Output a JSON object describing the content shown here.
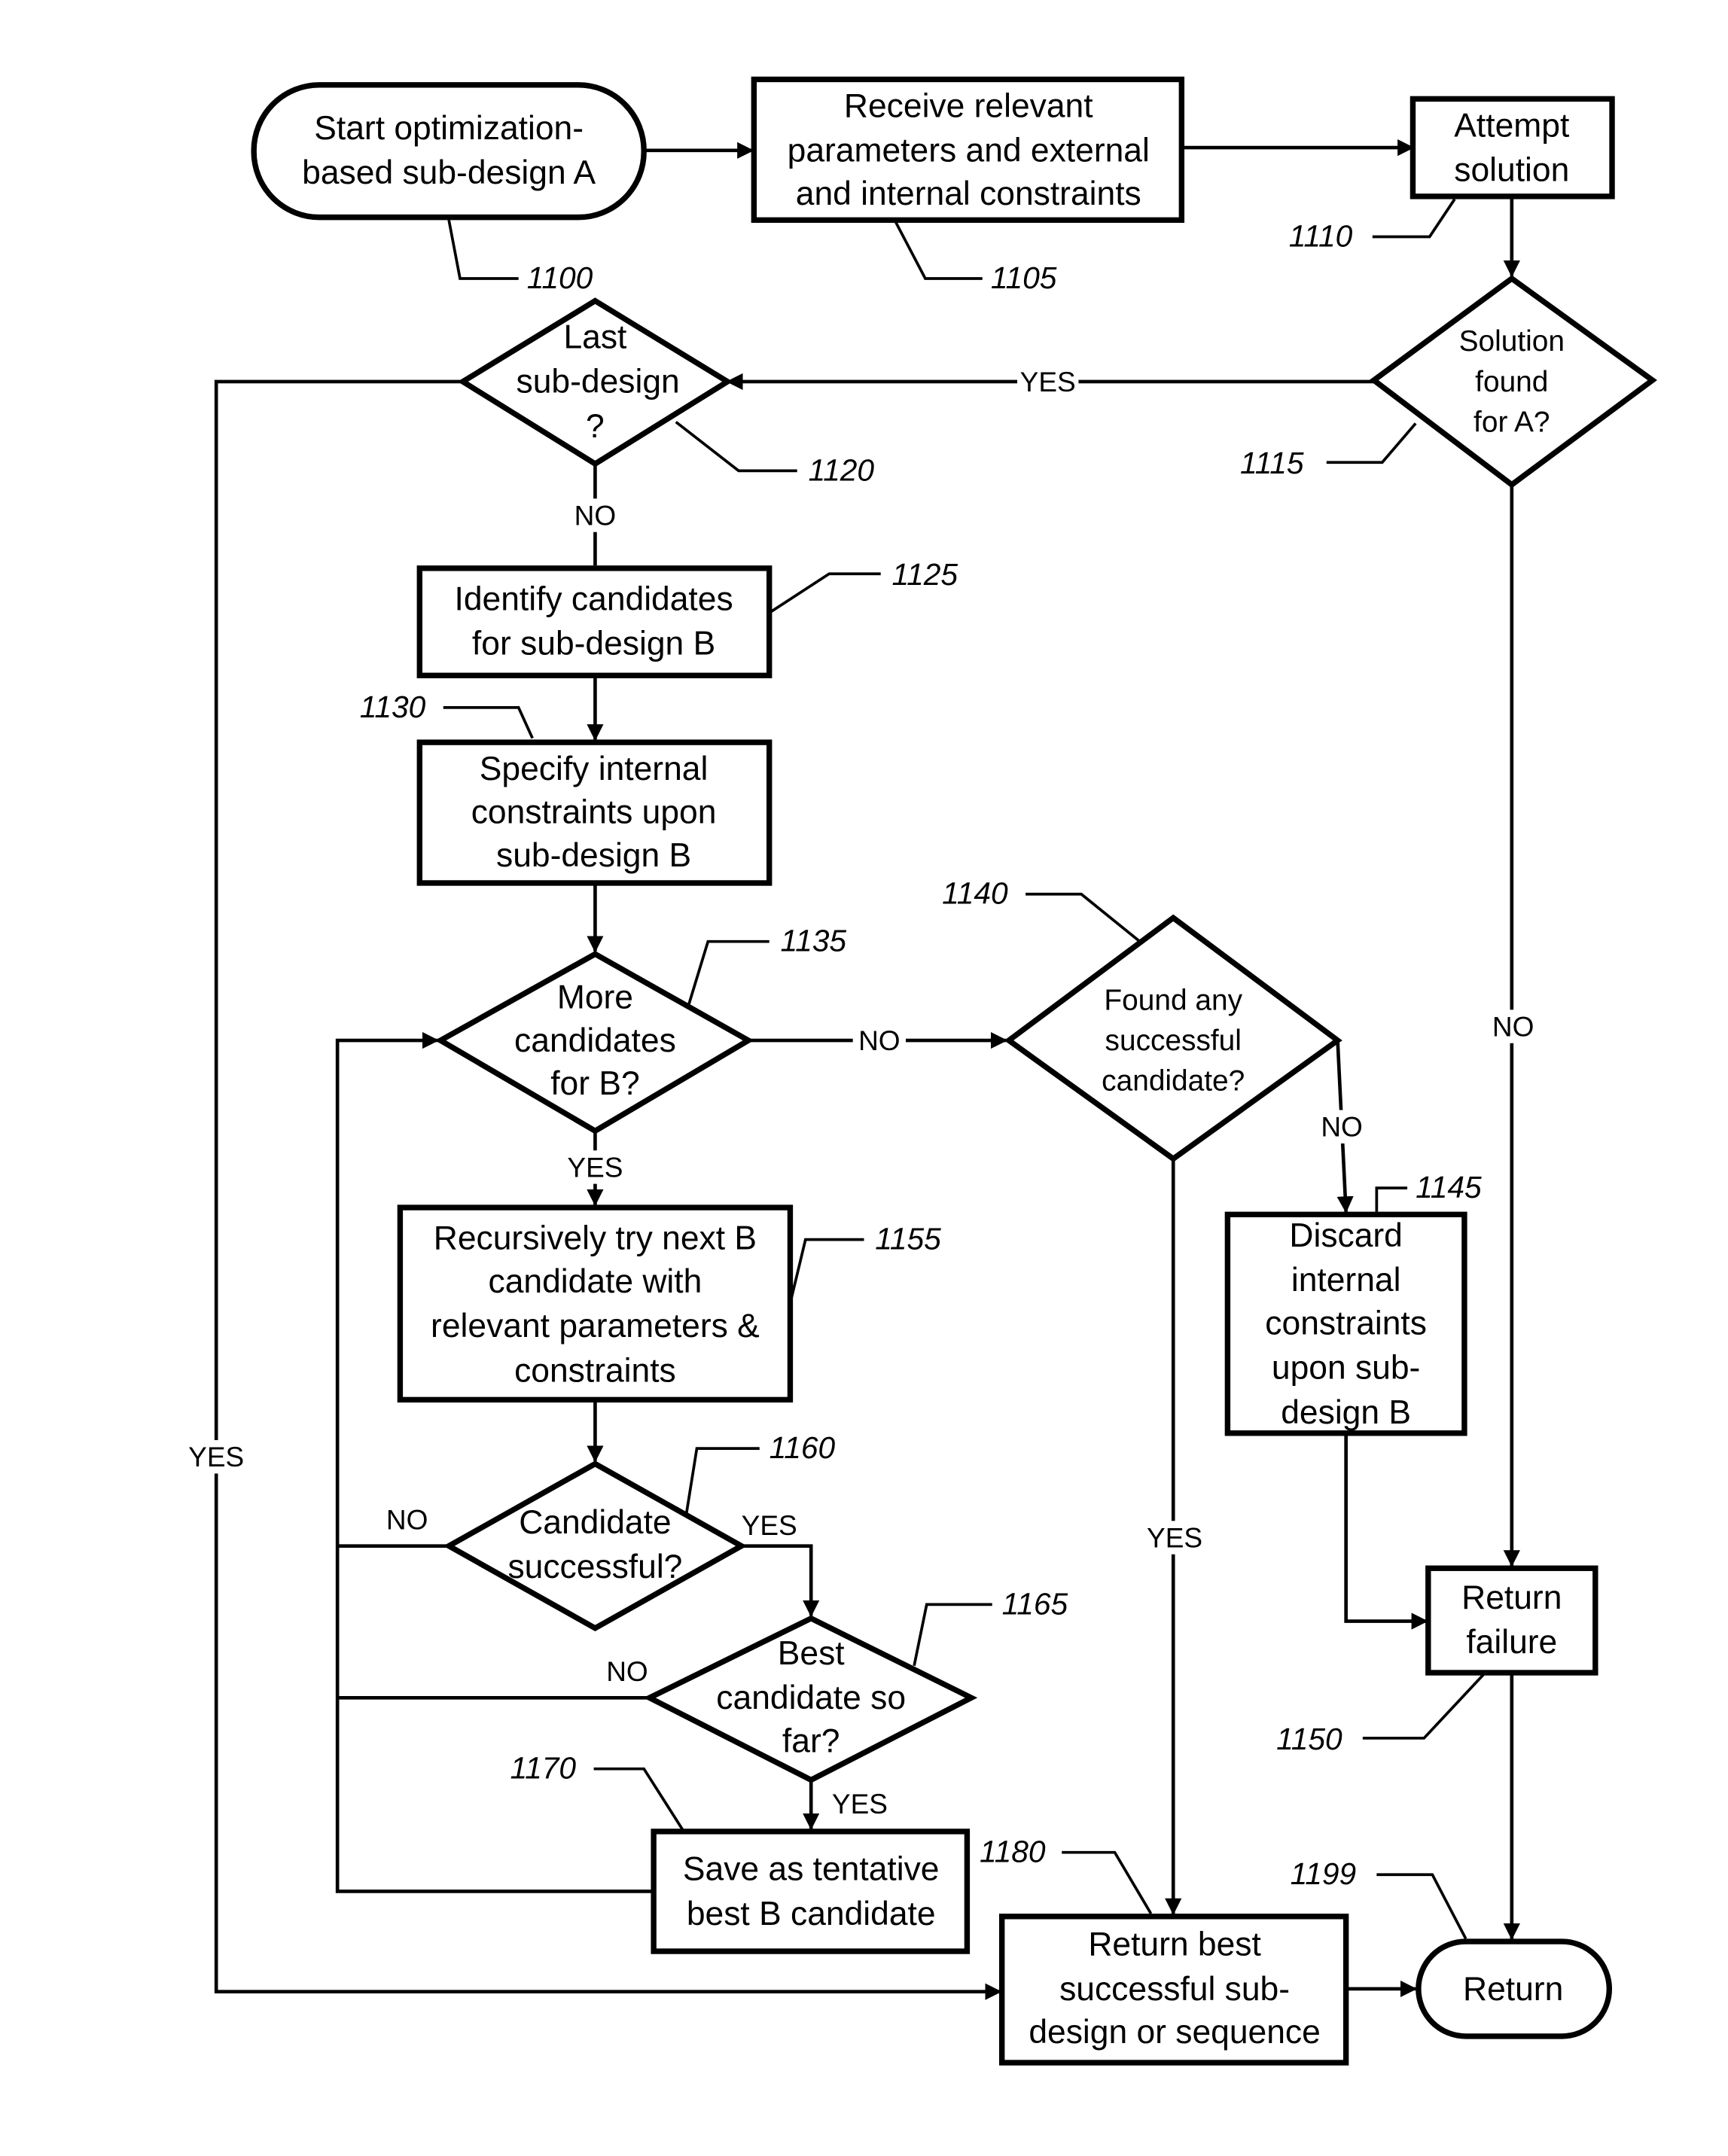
{
  "figure": {
    "nodes": {
      "n1100": {
        "ref": "1100",
        "lines": [
          "Start optimization-",
          "based sub-design A"
        ]
      },
      "n1105": {
        "ref": "1105",
        "lines": [
          "Receive relevant",
          "parameters and external",
          "and internal constraints"
        ]
      },
      "n1110": {
        "ref": "1110",
        "lines": [
          "Attempt",
          "solution"
        ]
      },
      "n1115": {
        "ref": "1115",
        "lines": [
          "Solution",
          "found",
          "for A?"
        ]
      },
      "n1120": {
        "ref": "1120",
        "lines": [
          "Last",
          "sub-design",
          "?"
        ]
      },
      "n1125": {
        "ref": "1125",
        "lines": [
          "Identify candidates",
          "for sub-design B"
        ]
      },
      "n1130": {
        "ref": "1130",
        "lines": [
          "Specify internal",
          "constraints upon",
          "sub-design B"
        ]
      },
      "n1135": {
        "ref": "1135",
        "lines": [
          "More",
          "candidates",
          "for B?"
        ]
      },
      "n1140": {
        "ref": "1140",
        "lines": [
          "Found any",
          "successful",
          "candidate?"
        ]
      },
      "n1145": {
        "ref": "1145",
        "lines": [
          "Discard",
          "internal",
          "constraints",
          "upon sub-",
          "design B"
        ]
      },
      "n1150": {
        "ref": "1150",
        "lines": [
          "Return",
          "failure"
        ]
      },
      "n1155": {
        "ref": "1155",
        "lines": [
          "Recursively try next B",
          "candidate with",
          "relevant parameters &",
          "constraints"
        ]
      },
      "n1160": {
        "ref": "1160",
        "lines": [
          "Candidate",
          "successful?"
        ]
      },
      "n1165": {
        "ref": "1165",
        "lines": [
          "Best",
          "candidate so",
          "far?"
        ]
      },
      "n1170": {
        "ref": "1170",
        "lines": [
          "Save as tentative",
          "best B candidate"
        ]
      },
      "n1180": {
        "ref": "1180",
        "lines": [
          "Return best",
          "successful sub-",
          "design or sequence"
        ]
      },
      "n1199": {
        "ref": "1199",
        "lines": [
          "Return"
        ]
      }
    },
    "edge_labels": {
      "yes_1115": "YES",
      "no_1115": "NO",
      "yes_1120": "YES",
      "no_1120": "NO",
      "no_1135": "NO",
      "yes_1135": "YES",
      "no_1140": "NO",
      "yes_1140": "YES",
      "no_1160": "NO",
      "yes_1160": "YES",
      "no_1165": "NO",
      "yes_1165": "YES"
    }
  }
}
